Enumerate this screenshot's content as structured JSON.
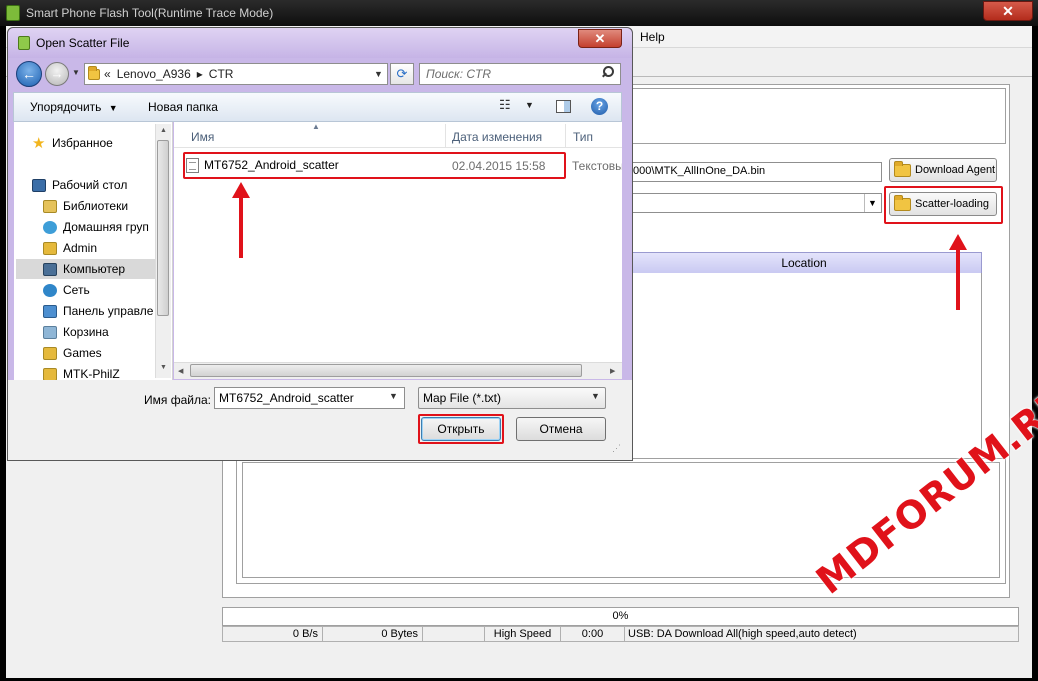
{
  "background_app": {
    "title": "Smart Phone Flash Tool(Runtime Trace Mode)",
    "menu_item": "Help",
    "download_agent_path": ".000\\MTK_AllInOne_DA.bin",
    "download_agent_button": "Download Agent",
    "scatter_button": "Scatter-loading",
    "table_header_location": "Location",
    "progress": "0%",
    "status": {
      "speed": "0 B/s",
      "bytes": "0 Bytes",
      "mode": "High Speed",
      "time": "0:00",
      "usb": "USB: DA Download All(high speed,auto detect)"
    }
  },
  "dialog": {
    "title": "Open Scatter File",
    "address": {
      "prefix": "«",
      "crumbs": [
        "Lenovo_A936",
        "CTR"
      ]
    },
    "search_placeholder": "Поиск: CTR",
    "toolbar": {
      "organize": "Упорядочить",
      "new_folder": "Новая папка"
    },
    "nav": {
      "items": [
        {
          "label": "Избранное",
          "icon": "star-icon",
          "color": "#f2b51d"
        },
        {
          "label": "Рабочий стол",
          "icon": "desktop-icon",
          "color": "#3b6ea8"
        },
        {
          "label": "Библиотеки",
          "icon": "library-icon",
          "color": "#e5c25a"
        },
        {
          "label": "Домашняя груп",
          "icon": "homegroup-icon",
          "color": "#3e9ed8"
        },
        {
          "label": "Admin",
          "icon": "user-folder-icon",
          "color": "#e5b93c"
        },
        {
          "label": "Компьютер",
          "icon": "computer-icon",
          "color": "#4a6f96"
        },
        {
          "label": "Сеть",
          "icon": "network-icon",
          "color": "#2f86c9"
        },
        {
          "label": "Панель управле",
          "icon": "control-panel-icon",
          "color": "#4d8fd0"
        },
        {
          "label": "Корзина",
          "icon": "recycle-bin-icon",
          "color": "#8fb6d6"
        },
        {
          "label": "Games",
          "icon": "folder-icon",
          "color": "#e5b93c"
        },
        {
          "label": "MTK-PhilZ",
          "icon": "folder-icon",
          "color": "#e5b93c"
        }
      ]
    },
    "columns": {
      "name": "Имя",
      "date": "Дата изменения",
      "type": "Тип"
    },
    "files": [
      {
        "name": "MT6752_Android_scatter",
        "date": "02.04.2015 15:58",
        "type": "Текстовый"
      }
    ],
    "filename_label": "Имя файла:",
    "filename_value": "MT6752_Android_scatter",
    "filter_value": "Map File (*.txt)",
    "open_button": "Открыть",
    "cancel_button": "Отмена"
  },
  "watermark": "MDFORUM.RU",
  "colors": {
    "highlight": "#e0121a",
    "dialog_frame": "#c9b8e8"
  }
}
